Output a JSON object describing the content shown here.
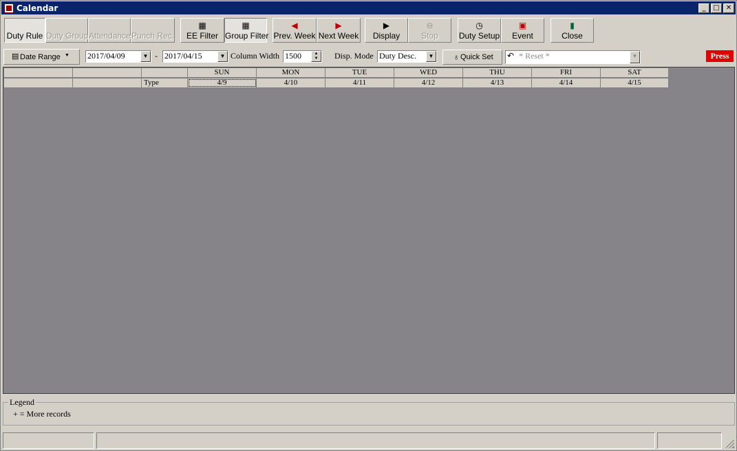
{
  "window": {
    "title": "Calendar"
  },
  "toolbar": {
    "duty_rule": "Duty Rule",
    "duty_group": "Duty Group",
    "attendance": "Attendance",
    "punch_rec": "Punch Rec.",
    "ee_filter": "EE Filter",
    "group_filter": "Group Filter",
    "prev_week": "Prev. Week",
    "next_week": "Next Week",
    "display": "Display",
    "stop": "Stop",
    "duty_setup": "Duty Setup",
    "event": "Event",
    "close": "Close"
  },
  "options": {
    "date_range_label": "Date Range",
    "date_from": "2017/04/09",
    "date_separator": "-",
    "date_to": "2017/04/15",
    "column_width_label": "Column Width",
    "column_width_value": "1500",
    "disp_mode_label": "Disp. Mode",
    "disp_mode_value": "Duty Desc.",
    "quick_set_label": "Quick Set",
    "reset_value": "* Reset *",
    "press_label": "Press"
  },
  "grid": {
    "days": [
      "SUN",
      "MON",
      "TUE",
      "WED",
      "THU",
      "FRI",
      "SAT"
    ],
    "dates": [
      "4/9",
      "4/10",
      "4/11",
      "4/12",
      "4/13",
      "4/14",
      "4/15"
    ],
    "type_label": "Type"
  },
  "legend": {
    "title": "Legend",
    "text": "+ = More records"
  },
  "colors": {
    "title_bar": "#0a246a",
    "grid_background": "#868488",
    "press_badge": "#e00000"
  }
}
